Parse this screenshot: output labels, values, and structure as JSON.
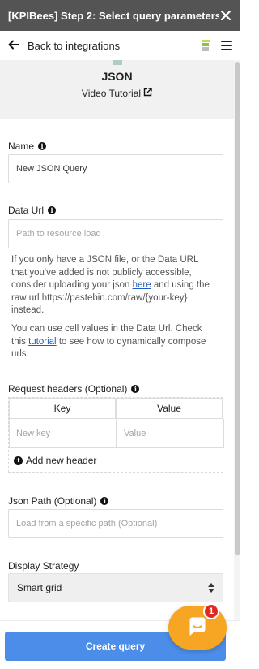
{
  "titlebar": {
    "title": "[KPIBees] Step 2: Select query parameters",
    "close_icon": "close-icon"
  },
  "nav": {
    "back_label": "Back to integrations",
    "back_icon": "arrow-left-icon",
    "extension_icon": "kpibees-icon",
    "menu_icon": "hamburger-menu-icon"
  },
  "source": {
    "title": "JSON",
    "tutorial_label": "Video Tutorial",
    "tutorial_icon": "external-link-icon"
  },
  "name_field": {
    "label": "Name",
    "value": "New JSON Query"
  },
  "data_url": {
    "label": "Data Url",
    "placeholder": "Path to resource load",
    "help1_before": "If you only have a JSON file, or the Data URL that you've added is not publicly accessible, consider uploading your json ",
    "help1_link": "here",
    "help1_after": " and using the raw url https://pastebin.com/raw/{your-key} instead.",
    "help2_before": "You can use cell values in the Data Url. Check this ",
    "help2_link": "tutorial",
    "help2_after": " to see how to dynamically compose urls."
  },
  "request_headers": {
    "label": "Request headers (Optional)",
    "columns": [
      "Key",
      "Value"
    ],
    "key_placeholder": "New key",
    "value_placeholder": "Value",
    "add_label": "Add new header"
  },
  "json_path": {
    "label": "Json Path (Optional)",
    "placeholder": "Load from a specific path (Optional)"
  },
  "display_strategy": {
    "label": "Display Strategy",
    "selected": "Smart grid"
  },
  "create_button": {
    "label": "Create query"
  },
  "chat": {
    "badge_count": "1",
    "icon": "chat-icon"
  },
  "colors": {
    "titlebar": "#545454",
    "primary": "#4b8de8",
    "chat": "#f6a623",
    "badge": "#e0291e",
    "link": "#1e5cc6"
  }
}
